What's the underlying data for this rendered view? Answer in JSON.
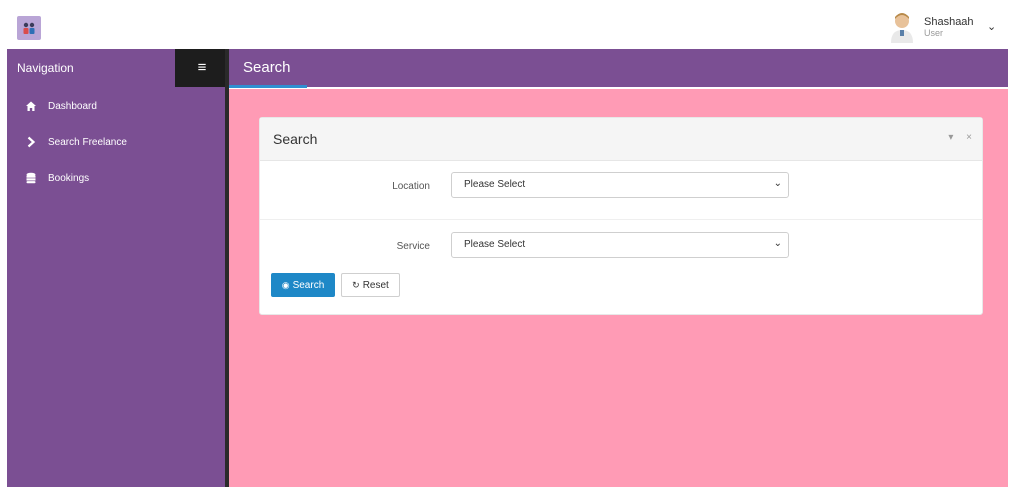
{
  "topbar": {
    "logo_icon": "team-logo-icon",
    "user": {
      "name": "Shashaah",
      "role": "User",
      "avatar_icon": "user-avatar-icon",
      "menu_icon": "chevron-down-icon"
    }
  },
  "sidebar": {
    "title": "Navigation",
    "toggle_icon": "≡",
    "items": [
      {
        "label": "Dashboard",
        "icon": "home-icon",
        "glyph": "⌂"
      },
      {
        "label": "Search Freelance",
        "icon": "chevron-right-icon",
        "glyph": "❯"
      },
      {
        "label": "Bookings",
        "icon": "database-icon",
        "glyph": "☰"
      }
    ]
  },
  "header": {
    "title": "Search"
  },
  "panel": {
    "title": "Search",
    "tools": [
      "▾",
      "×"
    ],
    "fields": [
      {
        "label": "Location",
        "value": "Please Select"
      },
      {
        "label": "Service",
        "value": "Please Select"
      }
    ],
    "buttons": {
      "search_label": "Search",
      "search_icon": "◉",
      "reset_label": "Reset",
      "reset_icon": "↻"
    }
  },
  "colors": {
    "sidebar": "#7b4f93",
    "content": "#ff9bb5",
    "accent": "#1e88c7",
    "toggle": "#1d1d1d"
  }
}
